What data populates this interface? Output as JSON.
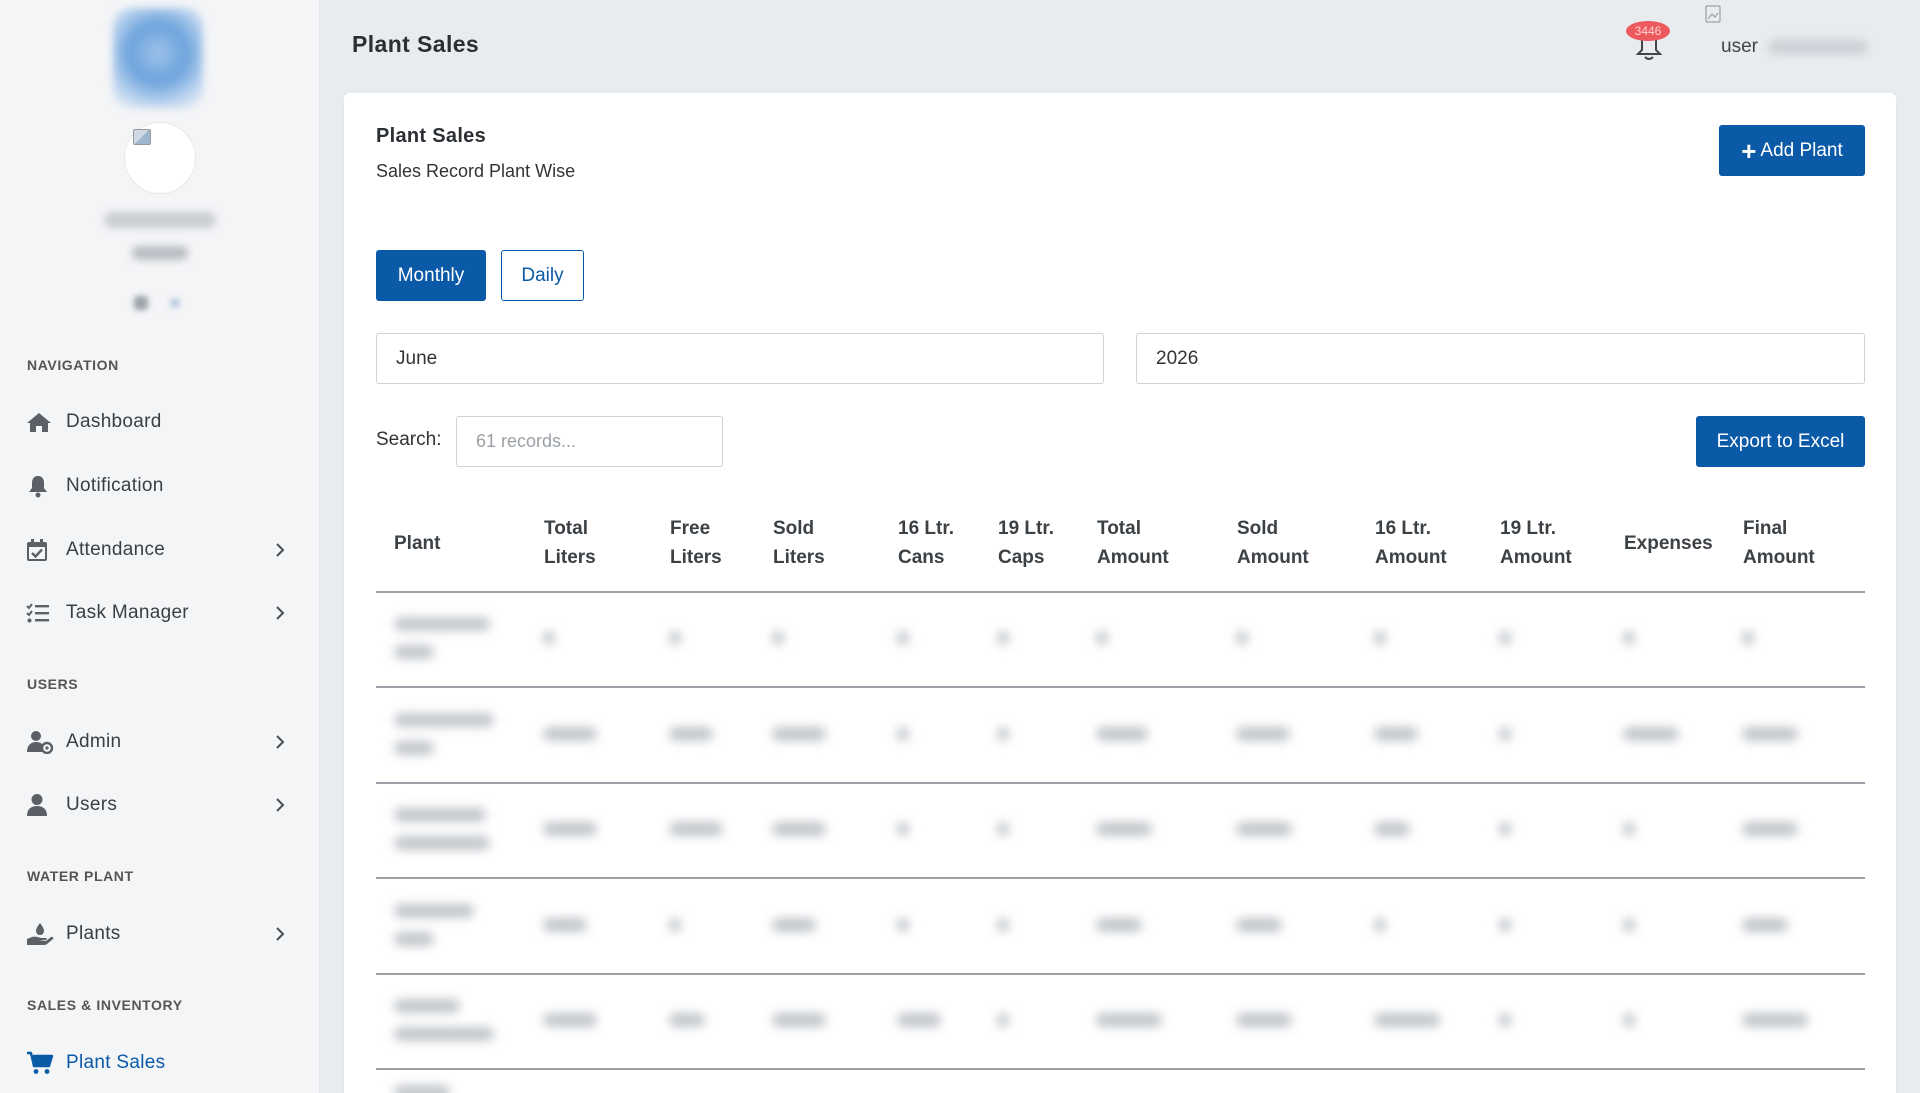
{
  "header": {
    "page_title": "Plant Sales",
    "notification_count": "3446",
    "user_label": "user"
  },
  "sidebar": {
    "sections": [
      {
        "title": "NAVIGATION",
        "items": [
          {
            "label": "Dashboard",
            "icon": "home-icon",
            "has_children": false
          },
          {
            "label": "Notification",
            "icon": "bell-icon",
            "has_children": false
          },
          {
            "label": "Attendance",
            "icon": "calendar-check-icon",
            "has_children": true
          },
          {
            "label": "Task Manager",
            "icon": "task-list-icon",
            "has_children": true
          }
        ]
      },
      {
        "title": "USERS",
        "items": [
          {
            "label": "Admin",
            "icon": "user-gear-icon",
            "has_children": true
          },
          {
            "label": "Users",
            "icon": "user-icon",
            "has_children": true
          }
        ]
      },
      {
        "title": "WATER PLANT",
        "items": [
          {
            "label": "Plants",
            "icon": "hand-holding-icon",
            "has_children": true
          }
        ]
      },
      {
        "title": "SALES & INVENTORY",
        "items": [
          {
            "label": "Plant Sales",
            "icon": "cart-icon",
            "has_children": false,
            "active": true
          }
        ]
      }
    ]
  },
  "card": {
    "title": "Plant Sales",
    "subtitle": "Sales Record Plant Wise",
    "add_button_label": "Add Plant",
    "toggle": {
      "monthly_label": "Monthly",
      "daily_label": "Daily",
      "selected": "Monthly"
    },
    "month_value": "June",
    "year_value": "2026",
    "search_label": "Search:",
    "search_placeholder": "61 records...",
    "export_label": "Export to Excel"
  },
  "table": {
    "columns": [
      [
        "Plant"
      ],
      [
        "Total",
        "Liters"
      ],
      [
        "Free",
        "Liters"
      ],
      [
        "Sold",
        "Liters"
      ],
      [
        "16 Ltr.",
        "Cans"
      ],
      [
        "19 Ltr.",
        "Caps"
      ],
      [
        "Total",
        "Amount"
      ],
      [
        "Sold",
        "Amount"
      ],
      [
        "16 Ltr.",
        "Amount"
      ],
      [
        "19 Ltr.",
        "Amount"
      ],
      [
        "Expenses"
      ],
      [
        "Final",
        "Amount"
      ]
    ]
  },
  "colors": {
    "primary": "#0b5aa7",
    "badge": "#ec5a5e",
    "sidebar_bg": "#f4f5f7",
    "page_bg": "#e9ecef"
  }
}
